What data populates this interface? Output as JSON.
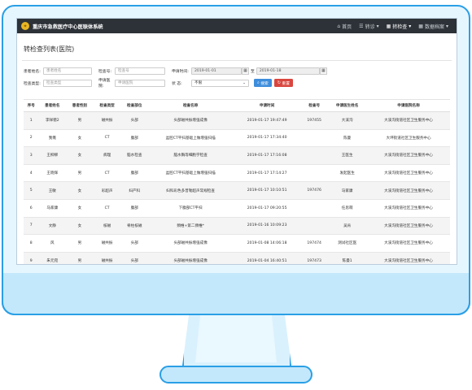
{
  "app": {
    "title": "重庆市急救医疗中心医联体系统",
    "logo_icon": "emblem-icon"
  },
  "nav": [
    {
      "label": "首页",
      "icon": "home-icon"
    },
    {
      "label": "转诊",
      "icon": "list-icon"
    },
    {
      "label": "转检查",
      "icon": "grid-icon"
    },
    {
      "label": "数据档案",
      "icon": "grid-icon"
    }
  ],
  "page_title": "转检查列表(医院)",
  "filters": {
    "patient_name_label": "患者姓名:",
    "patient_name_placeholder": "患者姓名",
    "exam_no_label": "检查号:",
    "exam_no_placeholder": "检查号",
    "apply_time_label": "申请时间:",
    "date_from": "2019-01-01",
    "date_sep": "至",
    "date_to": "2019-01-18",
    "exam_type_label": "检查类型:",
    "exam_type_placeholder": "检查类型",
    "apply_hospital_label": "申请医院:",
    "apply_hospital_placeholder": "申请医院",
    "status_label": "状 态:",
    "status_value": "不限",
    "search_button": "搜索",
    "reset_button": "重置"
  },
  "table": {
    "headers": [
      "序号",
      "患者姓名",
      "患者性别",
      "检查类型",
      "检查部位",
      "检查名称",
      "申请时间",
      "检查号",
      "申请医生姓名",
      "申请医院名称"
    ],
    "rows": [
      [
        "1",
        "李祥徳2",
        "男",
        "磁共振",
        "头部",
        "头部磁共振增强成像",
        "2019-01-17 19:47:49",
        "197455",
        "大溪沟",
        "大溪沟街道社区卫生服务中心"
      ],
      [
        "2",
        "我俺",
        "女",
        "CT",
        "腹部",
        "盆腔CT平扫基础上做增强扫描",
        "2019-01-17 17:34:40",
        "",
        "陈曼",
        "大坪街道社区卫生服务中心"
      ],
      [
        "3",
        "王柳柳",
        "女",
        "病理",
        "脑水检查",
        "脑水胸等细胞学检查",
        "2019-01-17 17:16:08",
        "",
        "王医生",
        "大溪沟街道社区卫生服务中心"
      ],
      [
        "4",
        "王晓辉",
        "男",
        "CT",
        "腹部",
        "盆腔CT平扫基础上做增强扫描",
        "2019-01-17 17:14:27",
        "",
        "发起医生",
        "大溪沟街道社区卫生服务中心"
      ],
      [
        "5",
        "王敏",
        "女",
        "彩超声",
        "妇产科",
        "妇科彩色多普勒超声常规检查",
        "2019-01-17 10:10:51",
        "197476",
        "马家康",
        "大溪沟街道社区卫生服务中心"
      ],
      [
        "6",
        "马家康",
        "女",
        "CT",
        "腹部",
        "下腹部CT平扫",
        "2019-01-17 09:20:55",
        "",
        "任思萌",
        "大溪沟街道社区卫生服务中心"
      ],
      [
        "7",
        "文静",
        "女",
        "核磁",
        "脊柱核磁",
        "颈椎+第二颈椎*",
        "2019-01-16 10:09:23",
        "",
        "吴肯",
        "大溪沟街道社区卫生服务中心"
      ],
      [
        "8",
        "风",
        "男",
        "磁共振",
        "头部",
        "头部磁共振增强成像",
        "2019-01-08 14:06:18",
        "197474",
        "测试社区医",
        "大溪沟街道社区卫生服务中心"
      ],
      [
        "9",
        "朱元宛",
        "男",
        "磁共振",
        "头部",
        "头部磁共振增强成像",
        "2019-01-04 16:40:51",
        "197473",
        "陈曼1",
        "大溪沟街道社区卫生服务中心"
      ]
    ]
  }
}
